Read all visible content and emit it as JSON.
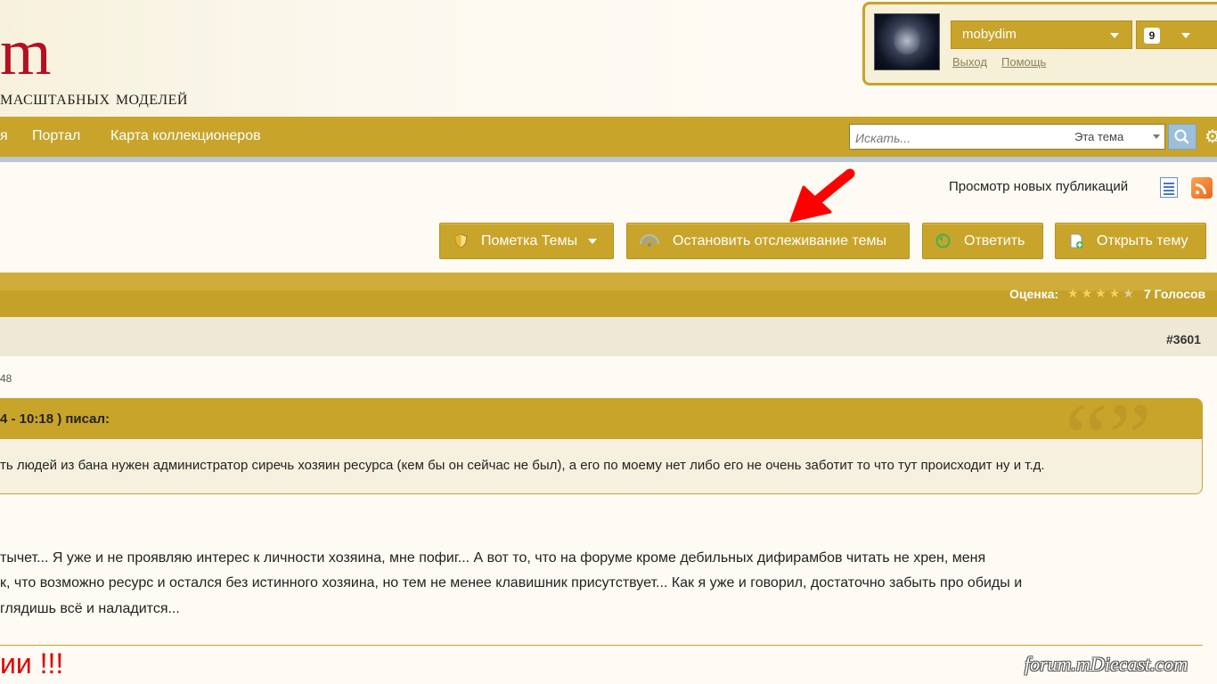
{
  "header": {
    "logo_mark": "m",
    "logo_subtitle": "масштабных моделей"
  },
  "user": {
    "username": "mobydim",
    "notification_count": "9",
    "logout_label": "Выход",
    "help_label": "Помощь"
  },
  "nav": {
    "items": [
      "я",
      "Портал",
      "Карта коллекционеров"
    ]
  },
  "search": {
    "placeholder": "Искать...",
    "scope": "Эта тема"
  },
  "new_publications_label": "Просмотр новых публикаций",
  "actions": {
    "mark_topic": "Пометка Темы",
    "stop_tracking": "Остановить отслеживание темы",
    "reply": "Ответить",
    "open_topic": "Открыть тему"
  },
  "topic": {
    "rating_label": "Оценка:",
    "rating_value": 4,
    "rating_max": 5,
    "votes": "7 Голосов"
  },
  "post": {
    "number": "#3601",
    "date_fragment": "48",
    "quote_header": "4 - 10:18 ) писал:",
    "quote_text": "ть людей из бана нужен администратор сиречь хозяин ресурса (кем бы он сейчас не был), а его по моему нет либо его не очень заботит то что тут происходит ну и т.д.",
    "body_lines": [
      "тычет... Я уже и не проявляю интерес к личности хозяина, мне пофиг... А вот то, что на форуме кроме дебильных дифирамбов читать не хрен, меня",
      "к, что возможно ресурс и остался без истинного хозяина, но тем не менее клавишник присутствует... Как я уже и говорил, достаточно забыть про обиды и",
      "глядишь всё и наладится..."
    ],
    "signature_red": "ии !!!"
  },
  "watermark": "forum.mDiecast.com",
  "colors": {
    "accent_gold": "#c8a42b",
    "logo_red": "#b40f23",
    "arrow_red": "#ff0000"
  }
}
